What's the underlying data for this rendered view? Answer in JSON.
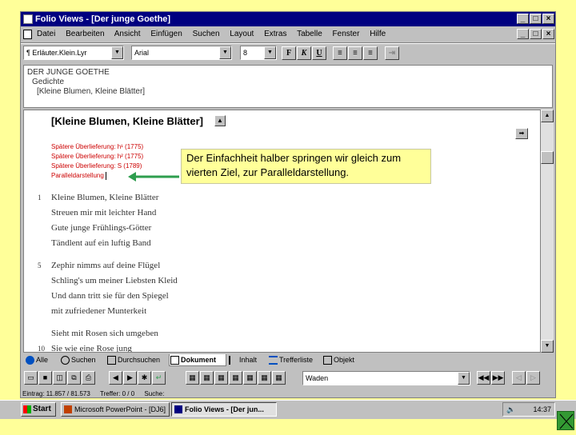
{
  "window": {
    "title": "Folio Views - [Der junge Goethe]",
    "controls": {
      "minimize": "_",
      "maximize": "□",
      "close": "×"
    }
  },
  "menu": {
    "items": [
      "Datei",
      "Bearbeiten",
      "Ansicht",
      "Einfügen",
      "Suchen",
      "Layout",
      "Extras",
      "Tabelle",
      "Fenster",
      "Hilfe"
    ]
  },
  "format_toolbar": {
    "style": "¶ Erläuter.Klein.Lyr",
    "font": "Arial",
    "size": "8",
    "bold": "F",
    "italic": "K",
    "underline": "U"
  },
  "header": {
    "lines": [
      "DER JUNGE GOETHE",
      "Gedichte",
      "[Kleine Blumen, Kleine Blätter]"
    ]
  },
  "content": {
    "title": "[Kleine Blumen, Kleine Blätter]",
    "up_icon": "▲",
    "side_icon": "➡",
    "red_links": [
      "Spätere Überlieferung: h¹ (1775)",
      "Spätere Überlieferung: h² (1775)",
      "Spätere Überlieferung: S (1789)",
      "Paralleldarstellung"
    ],
    "callout": "Der Einfachheit halber springen wir gleich zum vierten Ziel, zur Paralleldarstellung.",
    "stanzas": [
      {
        "number": "1",
        "lines": [
          "Kleine Blumen, Kleine Blätter",
          "Streuen mir mit leichter Hand",
          "Gute junge Frühlings-Götter",
          "Tändlent auf ein luftig Band"
        ]
      },
      {
        "number": "5",
        "lines": [
          "Zephir nimms auf deine Flügel",
          "Schling's um meiner Liebsten Kleid",
          "Und dann tritt sie für den Spiegel",
          "mit zufriedener Munterkeit"
        ]
      },
      {
        "number": "10",
        "lines": [
          "Sieht mit Rosen sich umgeben",
          "Sie wie eine Rose jung"
        ]
      }
    ]
  },
  "tabs": [
    {
      "label": "Alle",
      "icon": "globe-icon"
    },
    {
      "label": "Suchen",
      "icon": "search-icon"
    },
    {
      "label": "Durchsuchen",
      "icon": "book-icon"
    },
    {
      "label": "Dokument",
      "icon": "document-icon",
      "active": true
    },
    {
      "label": "Inhalt",
      "icon": "contents-icon"
    },
    {
      "label": "Trefferliste",
      "icon": "list-icon"
    },
    {
      "label": "Objekt",
      "icon": "object-icon"
    }
  ],
  "nav_toolbar": {
    "dropdown_value": "Waden"
  },
  "status": {
    "entry": "Eintrag: 11.857 / 81.573",
    "hits": "Treffer: 0 / 0",
    "search": "Suche:"
  },
  "taskbar": {
    "start": "Start",
    "items": [
      {
        "label": "Microsoft PowerPoint - [DJ6]",
        "active": false
      },
      {
        "label": "Folio Views - [Der jun...",
        "active": true
      }
    ],
    "time": "14:37"
  },
  "colors": {
    "desktop": "#ffff99",
    "titlebar": "#000080",
    "link_red": "#cc0000",
    "arrow_green": "#2e9e4e"
  }
}
